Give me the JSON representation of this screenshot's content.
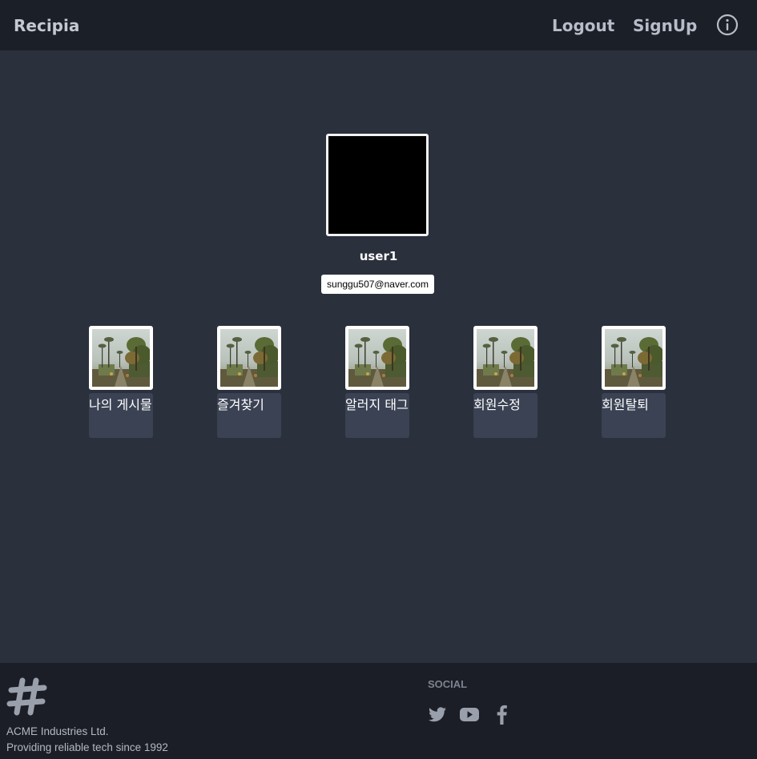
{
  "navbar": {
    "brand": "Recipia",
    "logout": "Logout",
    "signup": "SignUp",
    "info_icon": "info-circle-icon"
  },
  "profile": {
    "username": "user1",
    "email": "sunggu507@naver.com"
  },
  "menu": {
    "items": [
      {
        "label": "나의 게시물",
        "icon": "palm-street-photo"
      },
      {
        "label": "즐겨찾기",
        "icon": "palm-street-photo"
      },
      {
        "label": "알러지 태그",
        "icon": "palm-street-photo"
      },
      {
        "label": "회원수정",
        "icon": "palm-street-photo"
      },
      {
        "label": "회원탈퇴",
        "icon": "palm-street-photo"
      }
    ]
  },
  "footer": {
    "logo_icon": "hash-logo-icon",
    "company_name": "ACME Industries Ltd.",
    "tagline": "Providing reliable tech since 1992",
    "social_title": "SOCIAL",
    "social_icons": [
      "twitter-icon",
      "youtube-icon",
      "facebook-icon"
    ]
  },
  "colors": {
    "navbar_bg": "#1b1f27",
    "page_bg": "#2a303c",
    "label_bg": "#3a4253",
    "footer_bg": "#1b1e26"
  }
}
